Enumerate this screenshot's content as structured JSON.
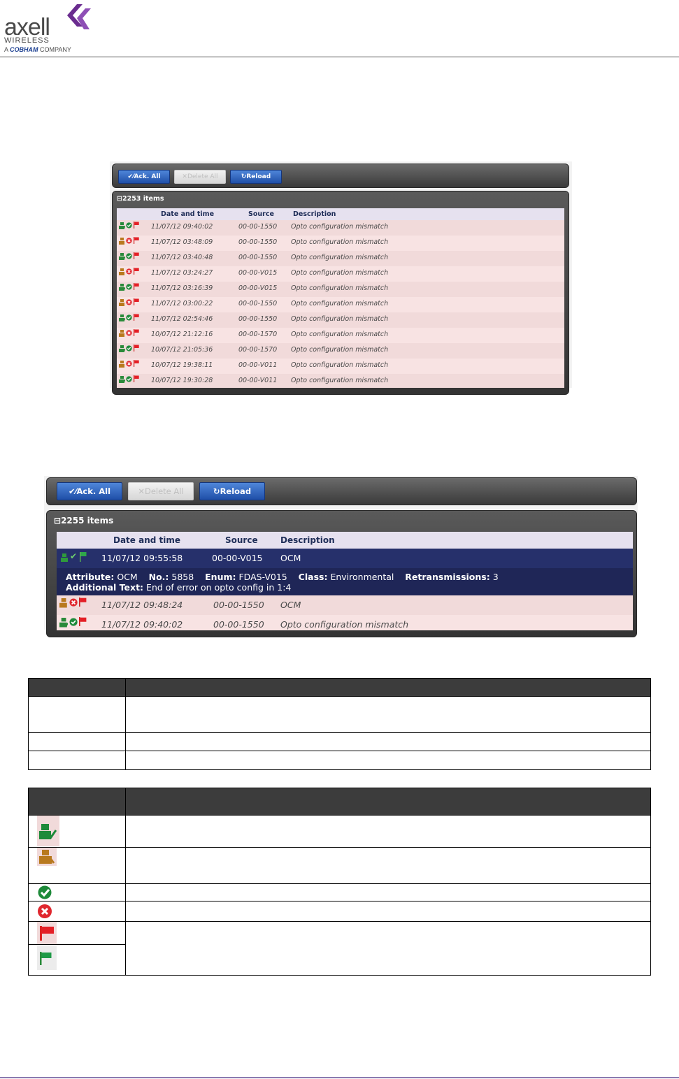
{
  "header": {
    "brand": "axell",
    "subbrand": "WIRELESS",
    "company_prefix": "A",
    "company_name": "COBHAM",
    "company_suffix": "COMPANY"
  },
  "screenshot1": {
    "buttons": {
      "ack": "Ack. All",
      "delete": "Delete All",
      "reload": "Reload"
    },
    "item_count": "2253 items",
    "columns": {
      "date": "Date and time",
      "source": "Source",
      "description": "Description"
    },
    "rows": [
      {
        "status": "ack",
        "date": "11/07/12 09:40:02",
        "source": "00-00-1550",
        "description": "Opto configuration mismatch"
      },
      {
        "status": "unack",
        "date": "11/07/12 03:48:09",
        "source": "00-00-1550",
        "description": "Opto configuration mismatch"
      },
      {
        "status": "ack",
        "date": "11/07/12 03:40:48",
        "source": "00-00-1550",
        "description": "Opto configuration mismatch"
      },
      {
        "status": "unack",
        "date": "11/07/12 03:24:27",
        "source": "00-00-V015",
        "description": "Opto configuration mismatch"
      },
      {
        "status": "ack",
        "date": "11/07/12 03:16:39",
        "source": "00-00-V015",
        "description": "Opto configuration mismatch"
      },
      {
        "status": "unack",
        "date": "11/07/12 03:00:22",
        "source": "00-00-1550",
        "description": "Opto configuration mismatch"
      },
      {
        "status": "ack",
        "date": "11/07/12 02:54:46",
        "source": "00-00-1550",
        "description": "Opto configuration mismatch"
      },
      {
        "status": "unack",
        "date": "10/07/12 21:12:16",
        "source": "00-00-1570",
        "description": "Opto configuration mismatch"
      },
      {
        "status": "ack",
        "date": "10/07/12 21:05:36",
        "source": "00-00-1570",
        "description": "Opto configuration mismatch"
      },
      {
        "status": "unack",
        "date": "10/07/12 19:38:11",
        "source": "00-00-V011",
        "description": "Opto configuration mismatch"
      },
      {
        "status": "ack",
        "date": "10/07/12 19:30:28",
        "source": "00-00-V011",
        "description": "Opto configuration mismatch"
      }
    ]
  },
  "screenshot2": {
    "buttons": {
      "ack": "Ack. All",
      "delete": "Delete All",
      "reload": "Reload"
    },
    "item_count": "2255 items",
    "columns": {
      "date": "Date and time",
      "source": "Source",
      "description": "Description"
    },
    "selected_row": {
      "date": "11/07/12 09:55:58",
      "source": "00-00-V015",
      "description": "OCM"
    },
    "detail": {
      "attribute_label": "Attribute:",
      "attribute_value": "OCM",
      "no_label": "No.:",
      "no_value": "5858",
      "enum_label": "Enum:",
      "enum_value": "FDAS-V015",
      "class_label": "Class:",
      "class_value": "Environmental",
      "retrans_label": "Retransmissions:",
      "retrans_value": "3",
      "additional_label": "Additional Text:",
      "additional_value": "End of error on opto config in 1:4"
    },
    "rows": [
      {
        "status": "unack",
        "date": "11/07/12 09:48:24",
        "source": "00-00-1550",
        "description": "OCM"
      },
      {
        "status": "ack",
        "date": "11/07/12 09:40:02",
        "source": "00-00-1550",
        "description": "Opto configuration mismatch"
      }
    ]
  },
  "icon_legend": {
    "icons": [
      "ack-person-icon",
      "unack-person-icon",
      "check-circle-icon",
      "x-circle-icon",
      "red-flag-icon",
      "green-flag-icon"
    ]
  },
  "colors": {
    "button_blue": "#2a5fc0",
    "row_pink": "#f1dada",
    "selected_navy": "#26306b",
    "header_dark": "#3c3c3c"
  }
}
